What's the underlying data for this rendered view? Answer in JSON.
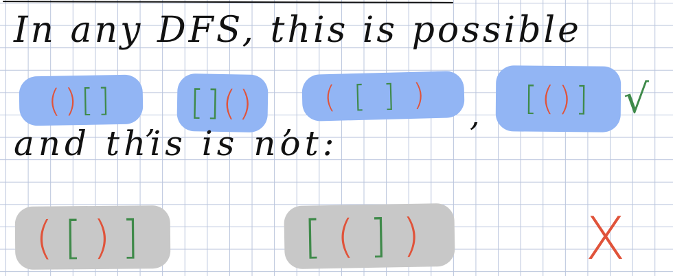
{
  "heading": "In any DFS, this is possible",
  "possible": [
    {
      "tokens": [
        {
          "ch": "(",
          "color": "#e0533a"
        },
        {
          "ch": ")",
          "color": "#e0533a"
        },
        {
          "ch": "[",
          "color": "#3f8a4a"
        },
        {
          "ch": "]",
          "color": "#3f8a4a"
        }
      ]
    },
    {
      "tokens": [
        {
          "ch": "[",
          "color": "#3f8a4a"
        },
        {
          "ch": "]",
          "color": "#3f8a4a"
        },
        {
          "ch": "(",
          "color": "#e0533a"
        },
        {
          "ch": ")",
          "color": "#e0533a"
        }
      ]
    },
    {
      "tokens": [
        {
          "ch": "(",
          "color": "#e0533a"
        },
        {
          "ch": "[",
          "color": "#3f8a4a"
        },
        {
          "ch": "]",
          "color": "#3f8a4a"
        },
        {
          "ch": ")",
          "color": "#e0533a"
        }
      ]
    },
    {
      "tokens": [
        {
          "ch": "[",
          "color": "#3f8a4a"
        },
        {
          "ch": "(",
          "color": "#e0533a"
        },
        {
          "ch": ")",
          "color": "#e0533a"
        },
        {
          "ch": "]",
          "color": "#3f8a4a"
        }
      ]
    }
  ],
  "separator": ",",
  "check_mark": "√",
  "subline": "and this is not:",
  "not_possible": [
    {
      "tokens": [
        {
          "ch": "(",
          "color": "#e0533a"
        },
        {
          "ch": "[",
          "color": "#3f8a4a"
        },
        {
          "ch": ")",
          "color": "#e0533a"
        },
        {
          "ch": "]",
          "color": "#3f8a4a"
        }
      ]
    },
    {
      "tokens": [
        {
          "ch": "[",
          "color": "#3f8a4a"
        },
        {
          "ch": "(",
          "color": "#e0533a"
        },
        {
          "ch": "]",
          "color": "#3f8a4a"
        },
        {
          "ch": ")",
          "color": "#e0533a"
        }
      ]
    }
  ],
  "cross_mark": "X",
  "colors": {
    "blue_highlight": "#92b5f4",
    "gray_highlight": "#c8c8c8",
    "paren": "#e0533a",
    "bracket": "#3f8a4a",
    "ink": "#111111",
    "grid": "#b9c4dc"
  }
}
